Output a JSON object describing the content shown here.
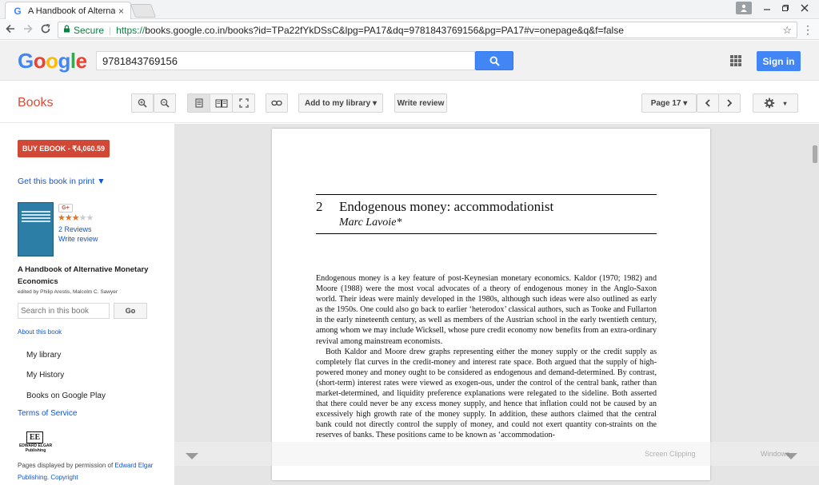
{
  "browser": {
    "tab_title": "A Handbook of Alternati",
    "tab_close": "×",
    "security_label": "Secure",
    "url_scheme": "https://",
    "url_rest": "books.google.co.in/books?id=TPa22fYkDSsC&lpg=PA17&dq=9781843769156&pg=PA17#v=onepage&q&f=false",
    "icons": [
      "back-icon",
      "forward-icon",
      "reload-icon",
      "lock-icon",
      "star-icon",
      "menu-icon",
      "user-icon",
      "minimize-icon",
      "maximize-icon",
      "close-icon"
    ]
  },
  "google": {
    "logo_text": "Google",
    "logo_colors": [
      "#4285f4",
      "#ea4335",
      "#fbbc05",
      "#4285f4",
      "#34a853",
      "#ea4335"
    ],
    "search_value": "9781843769156",
    "signin_label": "Sign in"
  },
  "toolbar": {
    "section_label": "Books",
    "add_library": "Add to my library ▾",
    "write_review": "Write review",
    "page_select": "Page 17 ▾"
  },
  "sidebar": {
    "buy_label": "BUY EBOOK - ₹4,060.59",
    "get_print": "Get this book in print ▼",
    "gplus": "G+",
    "rating": 3,
    "rating_max": 5,
    "reviews": "2 Reviews",
    "write_review": "Write review",
    "book_title": "A Handbook of Alternative Monetary Economics",
    "authors": "edited by Philip Arestis, Malcolm C. Sawyer",
    "search_placeholder": "Search in this book",
    "go_label": "Go",
    "about": "About this book",
    "nav": [
      "My library",
      "My History",
      "Books on Google Play"
    ],
    "terms": "Terms of Service",
    "publisher_logo": "EE",
    "publisher_name": "EDWARD ELGAR Publishing",
    "permission_prefix": "Pages displayed by permission of ",
    "permission_link": "Edward Elgar Publishing",
    "permission_suffix": ". ",
    "copyright": "Copyright"
  },
  "page": {
    "chapter_number": "2",
    "chapter_title": "Endogenous money: accommodationist",
    "chapter_author": "Marc Lavoie*",
    "paragraphs": [
      "Endogenous money is a key feature of post-Keynesian monetary economics. Kaldor (1970; 1982) and Moore (1988) were the most vocal advocates of a theory of endogenous money in the Anglo-Saxon world. Their ideas were mainly developed in the 1980s, although such ideas were also outlined as early as the 1950s. One could also go back to earlier ‘heterodox’ classical authors, such as Tooke and Fullarton in the early nineteenth century, as well as members of the Austrian school in the early twentieth century, among whom we may include Wicksell, whose pure credit economy now benefits from an extra-ordinary revival among mainstream economists.",
      "Both Kaldor and Moore drew graphs representing either the money supply or the credit supply as completely flat curves in the credit-money and interest rate space. Both argued that the supply of high-powered money and money ought to be considered as endogenous and demand-determined. By contrast, (short-term) interest rates were viewed as exogen-ous, under the control of the central bank, rather than market-determined, and liquidity preference explanations were relegated to the sideline. Both asserted that there could never be any excess money supply, and hence that inflation could not be caused by an excessively high growth rate of the money supply. In addition, these authors claimed that the central bank could not directly control the supply of money, and could not exert quantity con-straints on the reserves of banks. These positions came to be known as ‘accommodation-"
    ]
  },
  "overlay": {
    "watermark_left": "Screen Clipping",
    "watermark_right": "Windows"
  }
}
